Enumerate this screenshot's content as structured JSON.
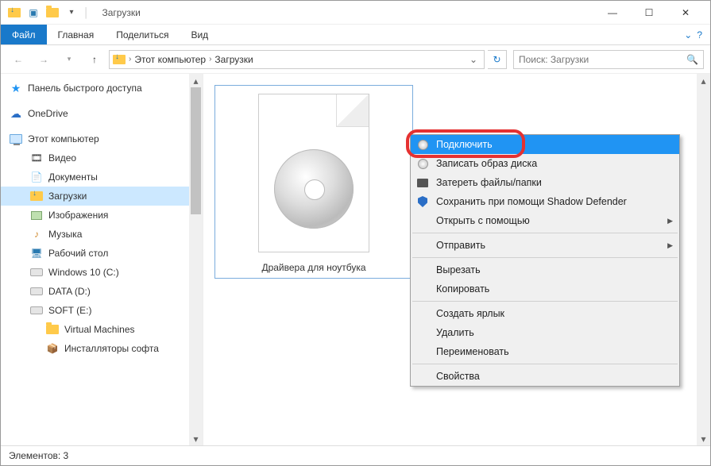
{
  "window": {
    "title": "Загрузки"
  },
  "ribbon": {
    "file": "Файл",
    "tabs": [
      "Главная",
      "Поделиться",
      "Вид"
    ]
  },
  "breadcrumb": {
    "root": "Этот компьютер",
    "current": "Загрузки"
  },
  "search": {
    "placeholder": "Поиск: Загрузки"
  },
  "sidebar": {
    "quick": "Панель быстрого доступа",
    "onedrive": "OneDrive",
    "thispc": "Этот компьютер",
    "items": [
      {
        "label": "Видео"
      },
      {
        "label": "Документы"
      },
      {
        "label": "Загрузки",
        "selected": true
      },
      {
        "label": "Изображения"
      },
      {
        "label": "Музыка"
      },
      {
        "label": "Рабочий стол"
      },
      {
        "label": "Windows 10 (C:)"
      },
      {
        "label": "DATA (D:)"
      },
      {
        "label": "SOFT (E:)"
      }
    ],
    "sub": [
      {
        "label": "Virtual Machines"
      },
      {
        "label": "Инсталляторы софта"
      }
    ]
  },
  "file": {
    "name": "Драйвера для ноутбука"
  },
  "context": {
    "mount": "Подключить",
    "burn": "Записать образ диска",
    "wipe": "Затереть файлы/папки",
    "shadow": "Сохранить при помощи Shadow Defender",
    "openwith": "Открыть с помощью",
    "sendto": "Отправить",
    "cut": "Вырезать",
    "copy": "Копировать",
    "shortcut": "Создать ярлык",
    "delete": "Удалить",
    "rename": "Переименовать",
    "properties": "Свойства"
  },
  "status": {
    "text": "Элементов: 3"
  }
}
